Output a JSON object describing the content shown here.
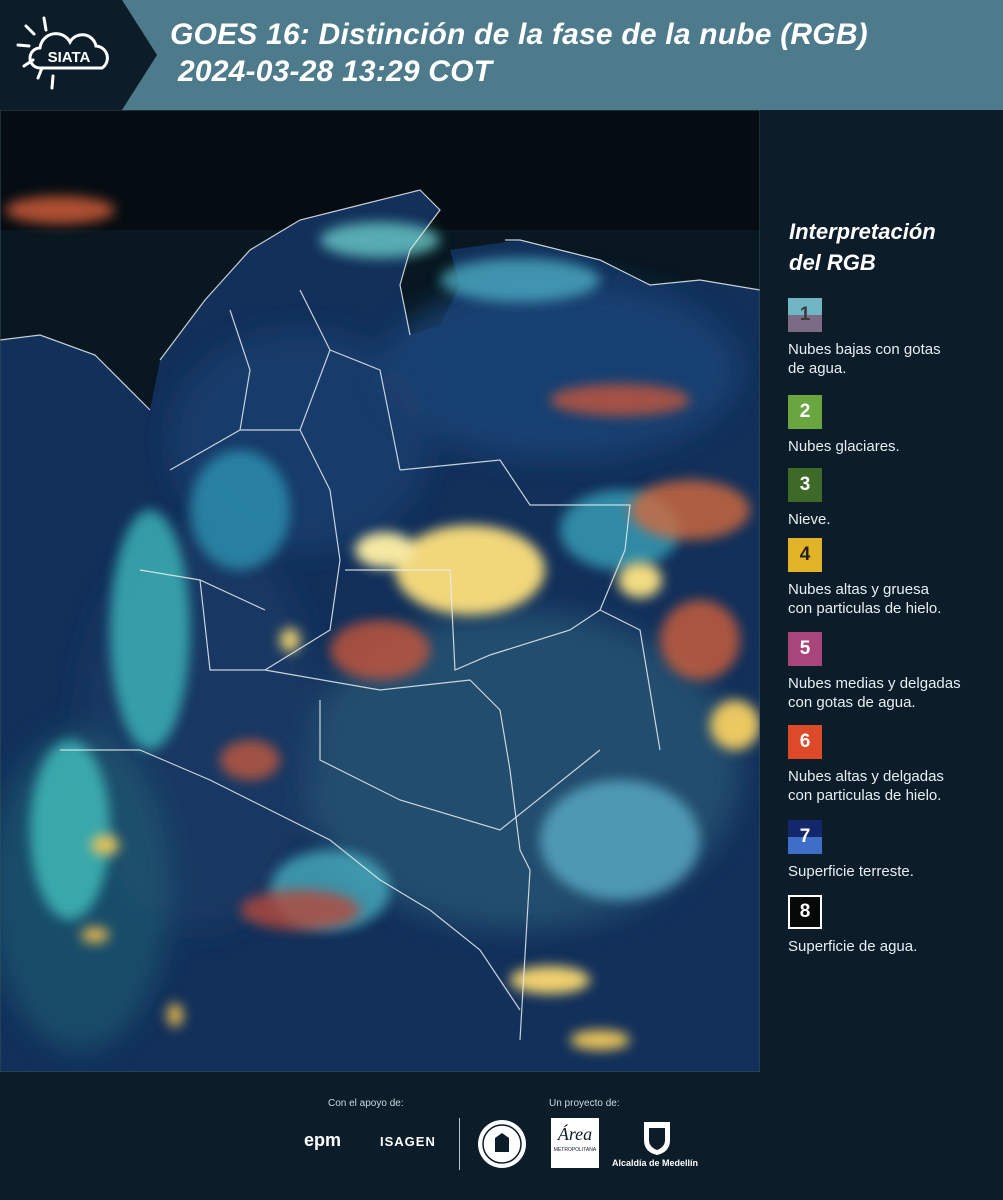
{
  "header": {
    "logo_text": "SIATA",
    "title_line1": "GOES 16: Distinción de la fase de la nube (RGB)",
    "title_line2": "2024-03-28 13:29 COT",
    "bg_color": "#4e7b8b"
  },
  "legend": {
    "title_line1": "Interpretación",
    "title_line2": "del RGB",
    "items": [
      {
        "num": "1",
        "label_line1": "Nubes bajas con gotas",
        "label_line2": "de agua.",
        "color_top": "#6fb5c4",
        "color_bottom": "#7c6b84"
      },
      {
        "num": "2",
        "label_line1": "Nubes glaciares.",
        "label_line2": "",
        "color_top": "#6aa640",
        "color_bottom": "#6aa640"
      },
      {
        "num": "3",
        "label_line1": "Nieve.",
        "label_line2": "",
        "color_top": "#3d6a26",
        "color_bottom": "#3d6a26"
      },
      {
        "num": "4",
        "label_line1": "Nubes altas y gruesa",
        "label_line2": "con particulas de hielo.",
        "color_top": "#e2b227",
        "color_bottom": "#e2b227"
      },
      {
        "num": "5",
        "label_line1": "Nubes medias y delgadas",
        "label_line2": "con gotas de agua.",
        "color_top": "#a8467c",
        "color_bottom": "#a8467c"
      },
      {
        "num": "6",
        "label_line1": "Nubes altas y delgadas",
        "label_line2": "con particulas de hielo.",
        "color_top": "#dc4a2a",
        "color_bottom": "#dc4a2a"
      },
      {
        "num": "7",
        "label_line1": "Superficie terreste.",
        "label_line2": "",
        "color_top": "#13276a",
        "color_bottom": "#3d6fc8"
      },
      {
        "num": "8",
        "label_line1": "Superficie de agua.",
        "label_line2": "",
        "color_top": "#050a08",
        "color_bottom": "#050a08"
      }
    ]
  },
  "footer": {
    "support_label": "Con el apoyo de:",
    "project_label": "Un proyecto de:",
    "epm": "epm",
    "isagen": "ISAGEN",
    "metro_text": "Área",
    "metro_sub": "METROPOLITANA",
    "alcaldia": "Alcaldía de Medellín"
  }
}
